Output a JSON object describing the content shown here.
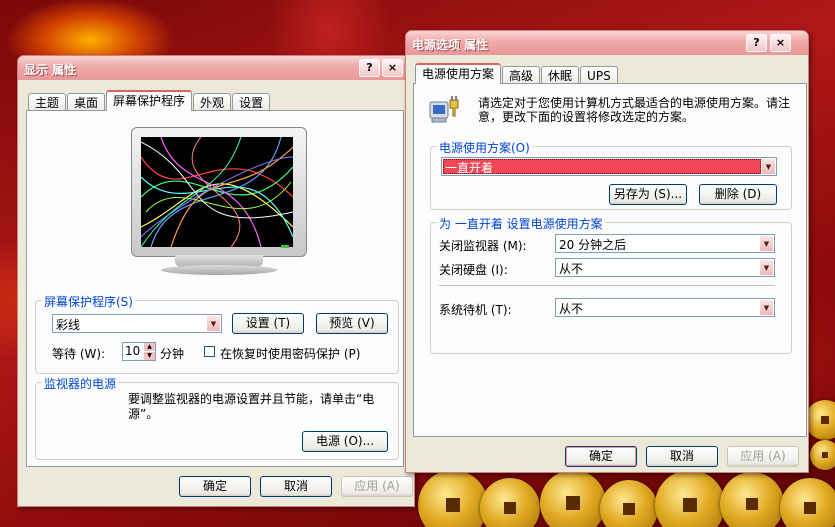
{
  "display_window": {
    "title": "显示 属性",
    "help_btn": "?",
    "close_btn": "×",
    "tabs": [
      "主题",
      "桌面",
      "屏幕保护程序",
      "外观",
      "设置"
    ],
    "screensaver_group": {
      "label": "屏幕保护程序(S)",
      "selected": "彩线",
      "settings_btn": "设置 (T)",
      "preview_btn": "预览 (V)",
      "wait_label": "等待 (W):",
      "wait_value": "10",
      "wait_unit": "分钟",
      "password_label": "在恢复时使用密码保护 (P)"
    },
    "monitor_group": {
      "label": "监视器的电源",
      "text": "要调整监视器的电源设置并且节能，请单击“电源”。",
      "power_btn": "电源 (O)..."
    },
    "ok": "确定",
    "cancel": "取消",
    "apply": "应用 (A)"
  },
  "power_window": {
    "title": "电源选项 属性",
    "help_btn": "?",
    "close_btn": "×",
    "tabs": [
      "电源使用方案",
      "高级",
      "休眠",
      "UPS"
    ],
    "intro": "请选定对于您使用计算机方式最适合的电源使用方案。请注意，更改下面的设置将修改选定的方案。",
    "scheme_group": {
      "label": "电源使用方案(O)",
      "selected": "一直开着",
      "save_as_btn": "另存为 (S)...",
      "delete_btn": "删除 (D)"
    },
    "settings_group": {
      "label": "为 一直开着 设置电源使用方案",
      "monitor_label": "关闭监视器 (M):",
      "monitor_value": "20 分钟之后",
      "disk_label": "关闭硬盘 (I):",
      "disk_value": "从不",
      "standby_label": "系统待机 (T):",
      "standby_value": "从不"
    },
    "ok": "确定",
    "cancel": "取消",
    "apply": "应用 (A)"
  },
  "colors": {
    "accent": "#e06060",
    "group_label": "#0046d5",
    "selection": "#f04858"
  }
}
